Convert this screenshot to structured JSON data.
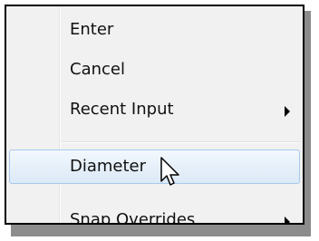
{
  "context_menu": {
    "items": [
      {
        "label": "Enter",
        "has_submenu": false
      },
      {
        "label": "Cancel",
        "has_submenu": false
      },
      {
        "label": "Recent Input",
        "has_submenu": true
      },
      {
        "label": "Diameter",
        "has_submenu": false,
        "highlighted": true
      },
      {
        "label": "Snap Overrides",
        "has_submenu": true
      }
    ]
  },
  "colors": {
    "menu_background": "#f1f1f1",
    "highlight_border": "#a8c8eb",
    "frame_border": "#000000",
    "shadow": "#8c8c8c"
  },
  "icons": [
    "submenu-arrow-icon",
    "mouse-pointer-icon"
  ]
}
